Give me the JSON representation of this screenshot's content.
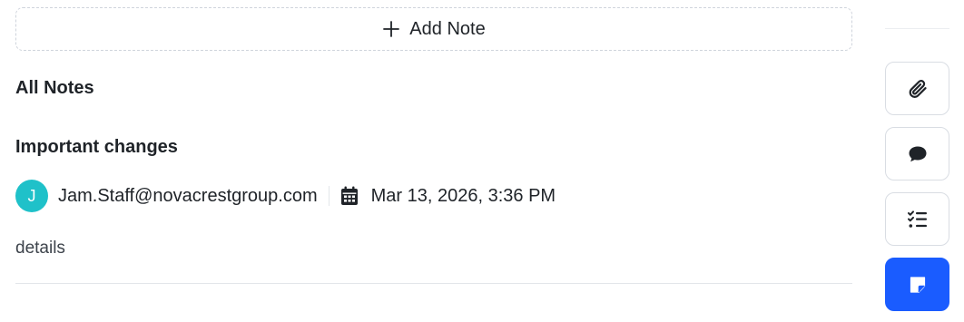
{
  "toolbar": {
    "add_note_label": "Add Note"
  },
  "notes_section": {
    "title": "All Notes",
    "notes": [
      {
        "title": "Important changes",
        "author_initial": "J",
        "author": "Jam.Staff@novacrestgroup.com",
        "timestamp": "Mar 13, 2026, 3:36 PM",
        "body": "details"
      }
    ]
  },
  "sidebar": {
    "items": [
      {
        "icon": "paperclip-icon",
        "active": false
      },
      {
        "icon": "chat-bubble-icon",
        "active": false
      },
      {
        "icon": "checklist-icon",
        "active": false
      },
      {
        "icon": "sticky-note-icon",
        "active": true
      }
    ]
  },
  "colors": {
    "accent": "#1a5cff",
    "avatar": "#1fc1c9",
    "border": "#d9dde3"
  }
}
